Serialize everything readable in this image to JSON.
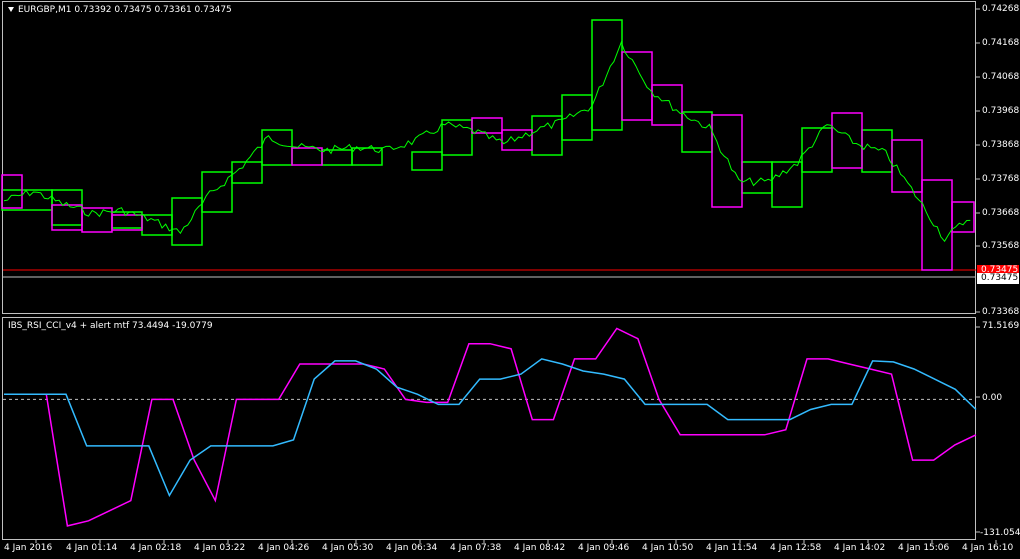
{
  "main_pane": {
    "symbol_header": "EURGBP,M1  0.73392 0.73475 0.73361 0.73475",
    "price_labels": [
      "0.74268",
      "0.74168",
      "0.74068",
      "0.73968",
      "0.73868",
      "0.73768",
      "0.73668",
      "0.73568",
      "0.73368"
    ],
    "current_price": "0.73475",
    "current_price_marker": "0.73475"
  },
  "indicator_pane": {
    "header": "IBS_RSI_CCI_v4 + alert mtf 73.4494 -19.0779",
    "labels": [
      "71.5169",
      "0.00",
      "-131.0545"
    ]
  },
  "time_axis": [
    "4 Jan 2016",
    "4 Jan 01:14",
    "4 Jan 02:18",
    "4 Jan 03:22",
    "4 Jan 04:26",
    "4 Jan 05:30",
    "4 Jan 06:34",
    "4 Jan 07:38",
    "4 Jan 08:42",
    "4 Jan 09:46",
    "4 Jan 10:50",
    "4 Jan 11:54",
    "4 Jan 12:58",
    "4 Jan 14:02",
    "4 Jan 15:06",
    "4 Jan 16:10"
  ],
  "colors": {
    "background": "#000000",
    "price_line": "#00ff00",
    "box_green": "#00ff00",
    "box_magenta": "#ff00ff",
    "indicator_blue": "#33bbff",
    "indicator_magenta": "#ff00ff",
    "current_price_line": "#ff0000",
    "grid": "#c0c0c0"
  },
  "chart_data": [
    {
      "type": "line",
      "series": [
        {
          "name": "EURGBP,M1",
          "values": [
            0.737,
            0.7373,
            0.7369,
            0.7366,
            0.7367,
            0.7364,
            0.736,
            0.7372,
            0.738,
            0.739,
            0.7387,
            0.7386,
            0.7387,
            0.7386,
            0.7389,
            0.7394,
            0.7392,
            0.7388,
            0.7392,
            0.7395,
            0.74,
            0.742,
            0.7405,
            0.7398,
            0.7393,
            0.7376,
            0.7376,
            0.7382,
            0.7394,
            0.7388,
            0.7385,
            0.7372,
            0.7358,
            0.7366
          ]
        }
      ],
      "ylim": [
        0.7333,
        0.7429
      ]
    },
    {
      "type": "line",
      "series": [
        {
          "name": "",
          "values": [
            5,
            5,
            5,
            5,
            -46,
            -46,
            -46,
            -46,
            -95,
            -60,
            -46,
            -46,
            -46,
            -46,
            -40,
            20,
            38,
            38,
            30,
            12,
            5,
            -5,
            -5,
            20,
            20,
            25,
            40,
            35,
            28,
            25,
            20,
            -5,
            -5,
            -5,
            -5,
            -20,
            -20,
            -20,
            -20,
            -10,
            -5,
            -5,
            38,
            37,
            30,
            20,
            10,
            -10
          ]
        },
        {
          "name": "",
          "values": [
            5,
            5,
            5,
            -125,
            -120,
            -110,
            -100,
            0,
            0,
            -60,
            -100,
            0,
            0,
            0,
            35,
            35,
            35,
            35,
            30,
            0,
            -3,
            -3,
            55,
            55,
            50,
            -20,
            -20,
            40,
            40,
            70,
            60,
            0,
            -35,
            -35,
            -35,
            -35,
            -35,
            -30,
            40,
            40,
            35,
            30,
            25,
            -60,
            -60,
            -45,
            -35
          ]
        }
      ],
      "ylim": [
        -131.0545,
        71.5169
      ]
    }
  ]
}
